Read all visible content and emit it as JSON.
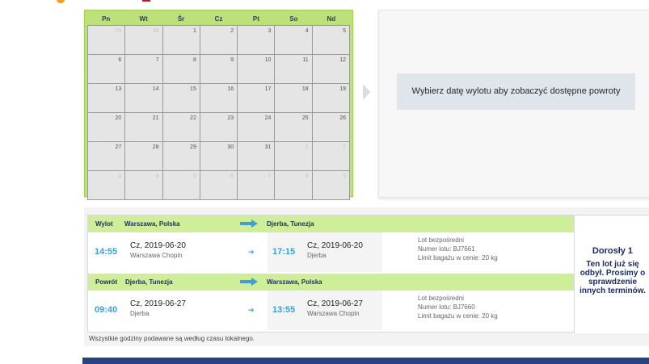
{
  "calendar": {
    "weekdays": [
      "Pn",
      "Wt",
      "Śr",
      "Cz",
      "Pt",
      "So",
      "Nd"
    ],
    "days": [
      {
        "d": "29",
        "muted": true
      },
      {
        "d": "30",
        "muted": true
      },
      {
        "d": "1"
      },
      {
        "d": "2"
      },
      {
        "d": "3"
      },
      {
        "d": "4"
      },
      {
        "d": "5"
      },
      {
        "d": "6"
      },
      {
        "d": "7"
      },
      {
        "d": "8"
      },
      {
        "d": "9"
      },
      {
        "d": "10"
      },
      {
        "d": "11"
      },
      {
        "d": "12"
      },
      {
        "d": "13"
      },
      {
        "d": "14"
      },
      {
        "d": "15"
      },
      {
        "d": "16"
      },
      {
        "d": "17"
      },
      {
        "d": "18"
      },
      {
        "d": "19"
      },
      {
        "d": "20"
      },
      {
        "d": "21"
      },
      {
        "d": "22"
      },
      {
        "d": "23"
      },
      {
        "d": "24"
      },
      {
        "d": "25"
      },
      {
        "d": "26"
      },
      {
        "d": "27"
      },
      {
        "d": "28"
      },
      {
        "d": "29"
      },
      {
        "d": "30"
      },
      {
        "d": "31"
      },
      {
        "d": "1",
        "muted": true
      },
      {
        "d": "2",
        "muted": true
      },
      {
        "d": "3",
        "muted": true
      },
      {
        "d": "4",
        "muted": true
      },
      {
        "d": "5",
        "muted": true
      },
      {
        "d": "6",
        "muted": true
      },
      {
        "d": "7",
        "muted": true
      },
      {
        "d": "8",
        "muted": true
      },
      {
        "d": "9",
        "muted": true
      }
    ]
  },
  "return_panel": {
    "message": "Wybierz datę wylotu aby zobaczyć dostępne powroty"
  },
  "outbound": {
    "label": "Wylot",
    "from_city": "Warszawa, Polska",
    "to_city": "Djerba, Tunezja",
    "dep_time": "14:55",
    "dep_date": "Cz, 2019-06-20",
    "dep_airport": "Warszawa Chopin",
    "arr_time": "17:15",
    "arr_date": "Cz, 2019-06-20",
    "arr_airport": "Djerba",
    "flight_type": "Lot bezpośredni",
    "flight_number": "Numer lotu: BJ7661",
    "baggage": "Limit bagażu w cenie: 20 kg"
  },
  "return": {
    "label": "Powrót",
    "from_city": "Djerba, Tunezja",
    "to_city": "Warszawa, Polska",
    "dep_time": "09:40",
    "dep_date": "Cz, 2019-06-27",
    "dep_airport": "Djerba",
    "arr_time": "13:55",
    "arr_date": "Cz, 2019-06-27",
    "arr_airport": "Warszawa Chopin",
    "flight_type": "Lot bezpośredni",
    "flight_number": "Numer lotu: BJ7660",
    "baggage": "Limit bagażu w cenie: 20 kg"
  },
  "price": {
    "passengers": "Dorosły 1",
    "notice": "Ten lot już się odbył. Prosimy o sprawdzenie innych terminów."
  },
  "footnote": "Wszystkie godziny podawane są według czasu lokalnego.",
  "colors": {
    "calendar_bg": "#bde07a",
    "leg_bar": "#cfee9a",
    "time_blue": "#3d9fd8",
    "navy": "#1c2c66",
    "bottom_bar": "#28437e"
  }
}
